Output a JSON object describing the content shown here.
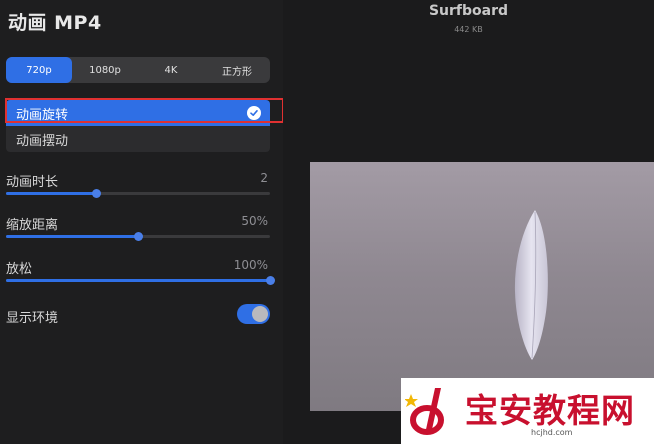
{
  "panel": {
    "title": "动画 MP4",
    "resolution_tabs": [
      {
        "label": "720p",
        "active": true
      },
      {
        "label": "1080p",
        "active": false
      },
      {
        "label": "4K",
        "active": false
      },
      {
        "label": "正方形",
        "active": false
      }
    ],
    "animation_options": [
      {
        "label": "动画旋转",
        "selected": true
      },
      {
        "label": "动画摆动",
        "selected": false
      }
    ],
    "sliders": [
      {
        "label": "动画时长",
        "value": "2",
        "fraction": 0.34
      },
      {
        "label": "缩放距离",
        "value": "50%",
        "fraction": 0.5
      },
      {
        "label": "放松",
        "value": "100%",
        "fraction": 1.0
      }
    ],
    "toggle": {
      "label": "显示环境",
      "on": true
    }
  },
  "preview": {
    "file_name": "Surfboard",
    "file_size": "442 KB"
  },
  "watermark": {
    "text": "宝安教程网",
    "url": "hcjhd.com"
  },
  "colors": {
    "accent": "#2f6fe5",
    "highlight_border": "#e03131",
    "watermark_red": "#c8102e"
  }
}
